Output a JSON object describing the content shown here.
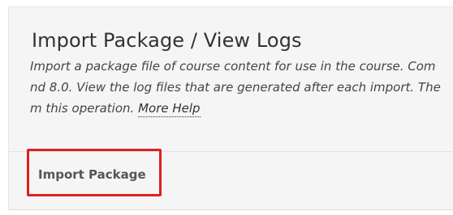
{
  "header": {
    "title": "Import Package / View Logs"
  },
  "description": {
    "line1": "Import a package file of course content for use in the course. Com",
    "line2": "nd 8.0. View the log files that are generated after each import. The",
    "line3_prefix": "m this operation.",
    "more_help_label": "More Help"
  },
  "actions": {
    "import_package_label": "Import Package"
  },
  "annotation": {
    "highlight_color": "#e02020"
  }
}
